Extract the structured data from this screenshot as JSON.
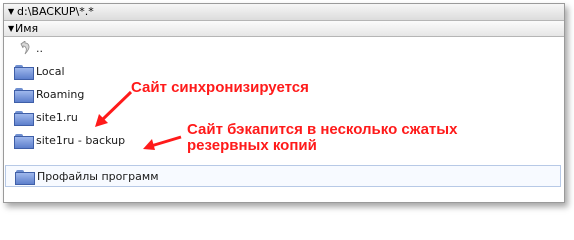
{
  "path_bar": {
    "path": "d:\\BACKUP\\*.*"
  },
  "column_header": {
    "name_label": "Имя"
  },
  "rows": [
    {
      "label": "..",
      "icon": "up-arrow-icon"
    },
    {
      "label": "Local",
      "icon": "folder-icon"
    },
    {
      "label": "Roaming",
      "icon": "folder-icon"
    },
    {
      "label": "site1.ru",
      "icon": "folder-icon"
    },
    {
      "label": "site1ru - backup",
      "icon": "folder-icon"
    },
    {
      "label": "Профайлы программ",
      "icon": "folder-icon"
    }
  ],
  "annotations": {
    "sync": "Сайт синхронизируется",
    "backup_line1": "Сайт бэкапится в несколько сжатых",
    "backup_line2": "резервных копий"
  },
  "colors": {
    "annotation": "#ff1a1a",
    "folder": "#6f8fd0",
    "selection_border": "#b7c9e6"
  }
}
